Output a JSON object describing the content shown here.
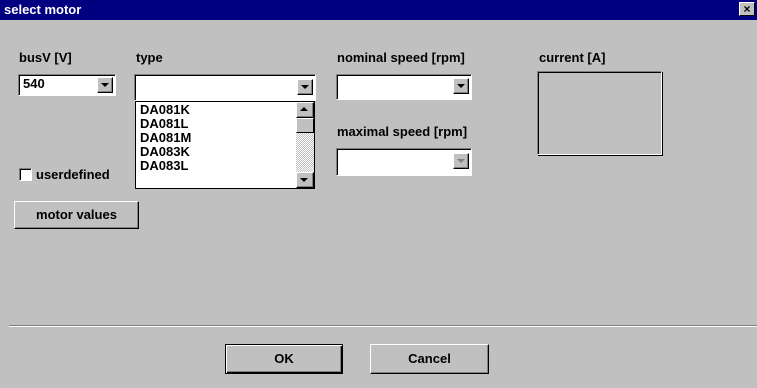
{
  "window": {
    "title": "select motor",
    "close_glyph": "×"
  },
  "busv": {
    "label": "busV [V]",
    "value": "540"
  },
  "type": {
    "label": "type",
    "value": "",
    "list_items": [
      "DA081K",
      "DA081L",
      "DA081M",
      "DA083K",
      "DA083L"
    ]
  },
  "nominal_speed": {
    "label": "nominal speed [rpm]",
    "value": ""
  },
  "maximal_speed": {
    "label": "maximal speed [rpm]",
    "value": ""
  },
  "current": {
    "label": "current [A]"
  },
  "userdefined": {
    "label": "userdefined",
    "checked": false
  },
  "buttons": {
    "motor_values": "motor values",
    "ok": "OK",
    "cancel": "Cancel"
  },
  "colors": {
    "titlebar": "#000080",
    "face": "#c0c0c0"
  }
}
